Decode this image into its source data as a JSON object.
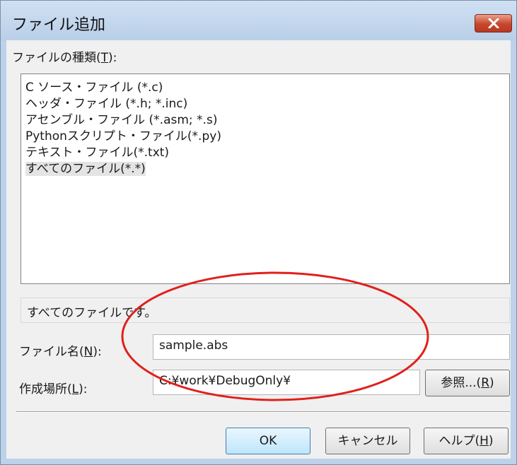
{
  "dialog": {
    "title": "ファイル追加",
    "close_symbol": "×"
  },
  "file_type": {
    "label": "ファイルの種類(",
    "accel": "T",
    "label_tail": "):",
    "items": [
      "C ソース・ファイル (*.c)",
      "ヘッダ・ファイル (*.h; *.inc)",
      "アセンブル・ファイル (*.asm; *.s)",
      "Pythonスクリプト・ファイル(*.py)",
      "テキスト・ファイル(*.txt)",
      "すべてのファイル(*.*)"
    ],
    "selected_index": 5
  },
  "description": "すべてのファイルです。",
  "file_name": {
    "label": "ファイル名(",
    "accel": "N",
    "label_tail": "):",
    "value": "sample.abs"
  },
  "location": {
    "label": "作成場所(",
    "accel": "L",
    "label_tail": "):",
    "value": "C:¥work¥DebugOnly¥",
    "browse_label": "参照...(",
    "browse_accel": "R",
    "browse_tail": ")"
  },
  "buttons": {
    "ok": "OK",
    "cancel": "キャンセル",
    "help_label": "ヘルプ(",
    "help_accel": "H",
    "help_tail": ")"
  },
  "colors": {
    "annotation_ellipse": "#e0201b",
    "close_button": "#c8452c"
  }
}
